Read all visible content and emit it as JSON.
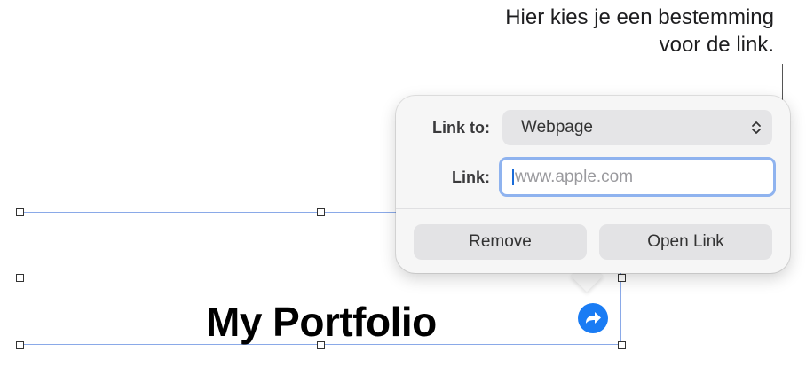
{
  "callout": {
    "line1": "Hier kies je een bestemming",
    "line2": "voor de link."
  },
  "document": {
    "title": "My Portfolio",
    "link_badge_icon": "link-arrow-icon"
  },
  "link_popover": {
    "link_to_label": "Link to:",
    "link_to_value": "Webpage",
    "link_label": "Link:",
    "link_value": "",
    "link_placeholder": "www.apple.com",
    "remove_label": "Remove",
    "open_link_label": "Open Link"
  },
  "colors": {
    "accent": "#1a7cf4",
    "focus_ring": "#8fb3ef",
    "selection_border": "#8aa9e8"
  }
}
